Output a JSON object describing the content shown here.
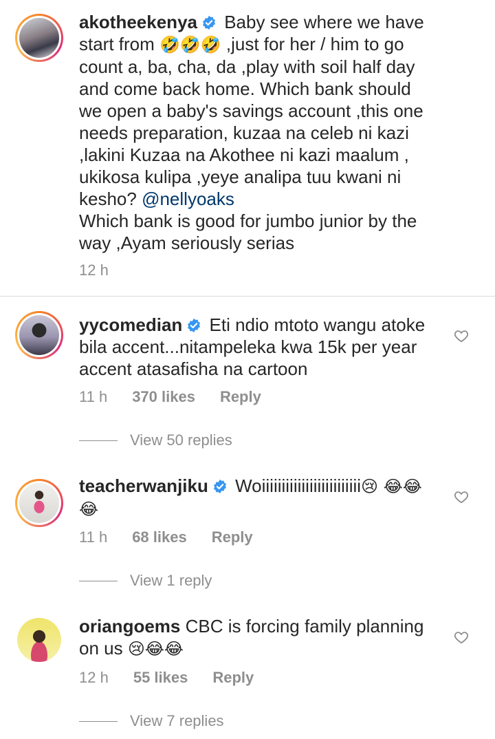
{
  "colors": {
    "text": "#262626",
    "muted": "#8e8e8e",
    "mention": "#00376b",
    "verified": "#3897f0"
  },
  "caption": {
    "username": "akotheekenya",
    "text_a": "Baby see where we have start from ",
    "emoji_a": "🤣🤣🤣",
    "text_b": " ,just for her / him to go count a, ba, cha, da ,play with soil half day and come back home. Which bank should we open a baby's savings account ,this one needs preparation, kuzaa na celeb ni kazi ,lakini Kuzaa na Akothee ni kazi maalum , ukikosa kulipa ,yeye analipa tuu kwani ni kesho? ",
    "mention": "@nellyoaks",
    "text_c": "\nWhich bank is good for jumbo junior by the way ,Ayam seriously serias",
    "time": "12 h"
  },
  "comments": [
    {
      "username": "yycomedian",
      "text": "Eti ndio mtoto wangu atoke bila accent...nitampeleka kwa 15k per year accent atasafisha na cartoon",
      "emoji": "",
      "time": "11 h",
      "likes": "370 likes",
      "reply": "Reply",
      "view_replies": "View 50 replies"
    },
    {
      "username": "teacherwanjiku",
      "text": "Woiiiiiiiiiiiiiiiiiiiiiiiii",
      "emoji": "😢 😂😂😂",
      "time": "11 h",
      "likes": "68 likes",
      "reply": "Reply",
      "view_replies": "View 1 reply"
    },
    {
      "username": "oriangoems",
      "text": "CBC is forcing family planning on us ",
      "emoji": "😢😂😂",
      "time": "12 h",
      "likes": "55 likes",
      "reply": "Reply",
      "view_replies": "View 7 replies"
    }
  ]
}
